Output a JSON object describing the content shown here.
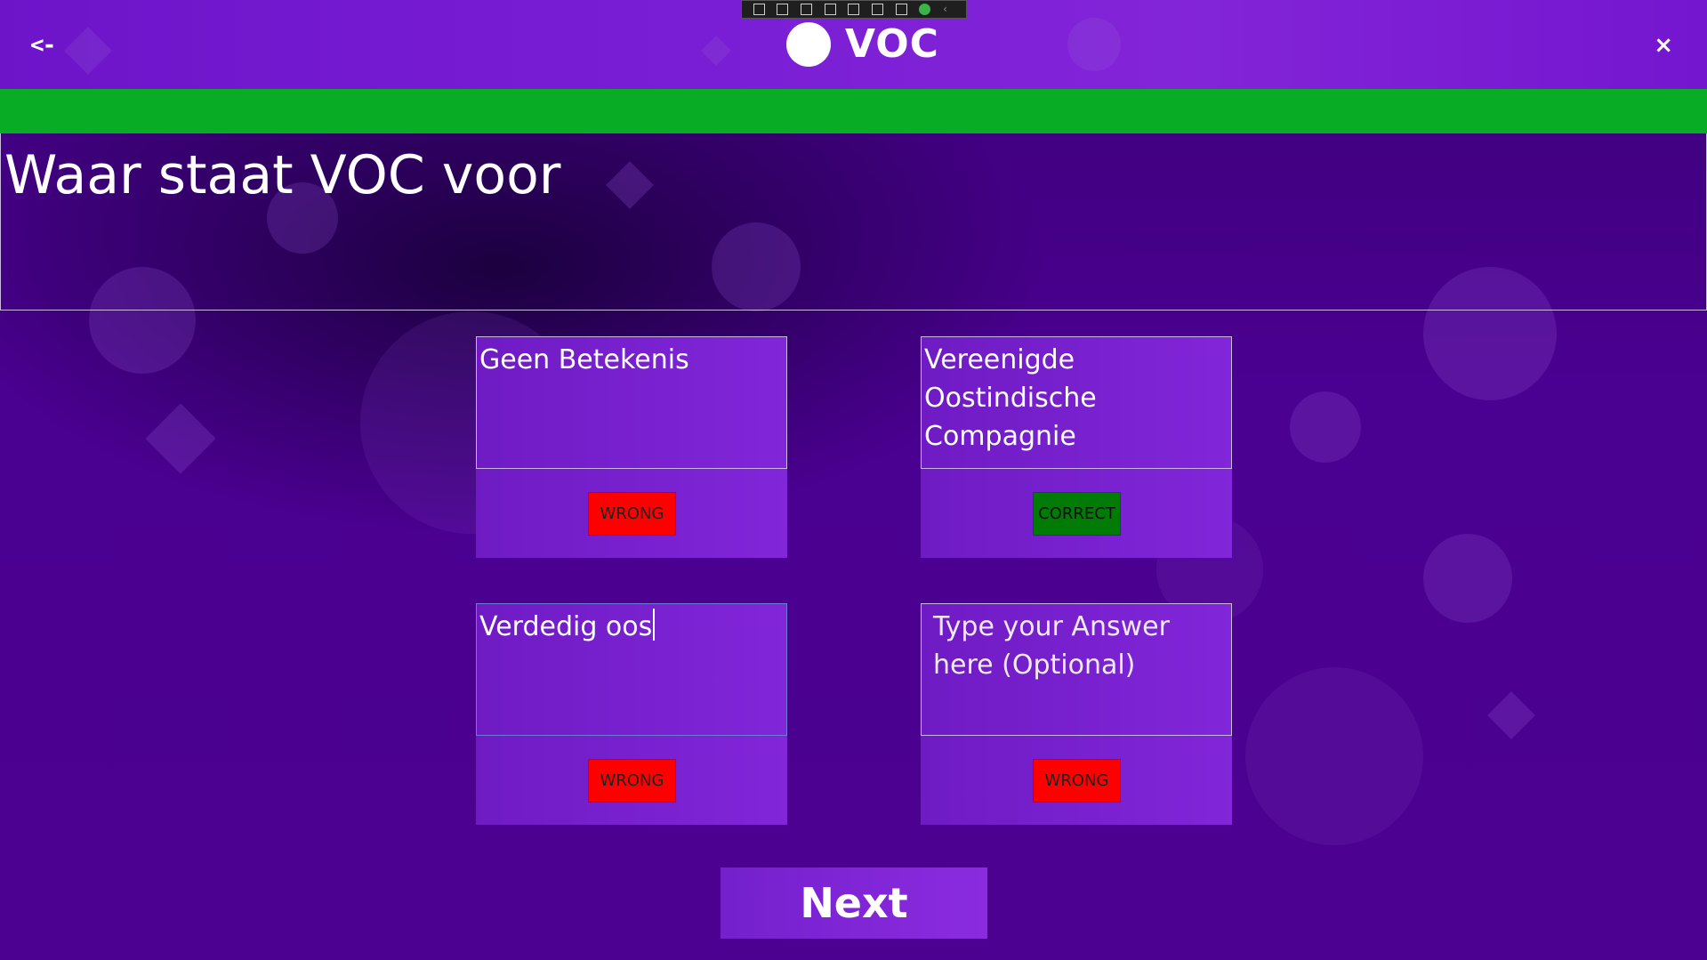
{
  "header": {
    "back_label": "<-",
    "title": "VOC",
    "close_label": "×"
  },
  "colors": {
    "header": "#7b1fd6",
    "progress": "#08ac25",
    "wrong": "#fe0000",
    "correct": "#007b05",
    "background": "#4a0090"
  },
  "progress": {
    "percent": 100
  },
  "question": {
    "text": "Waar staat VOC voor"
  },
  "answers": [
    {
      "text": "Geen Betekenis",
      "status": "WRONG"
    },
    {
      "text": "Vereenigde\nOostindische\nCompagnie",
      "status": "CORRECT"
    },
    {
      "text": "Verdedig oos",
      "status": "WRONG"
    },
    {
      "text": "",
      "placeholder": "Type your Answer here (Optional)",
      "status": "WRONG"
    }
  ],
  "next_label": "Next",
  "debug_toolbar": {
    "icons": [
      "live-visual-tree-icon",
      "record-icon",
      "select-element-icon",
      "display-layout-adorners-icon",
      "track-focus-icon",
      "hot-reload-icon",
      "accessibility-icon",
      "checkmark-icon",
      "collapse-chevron-icon"
    ]
  }
}
